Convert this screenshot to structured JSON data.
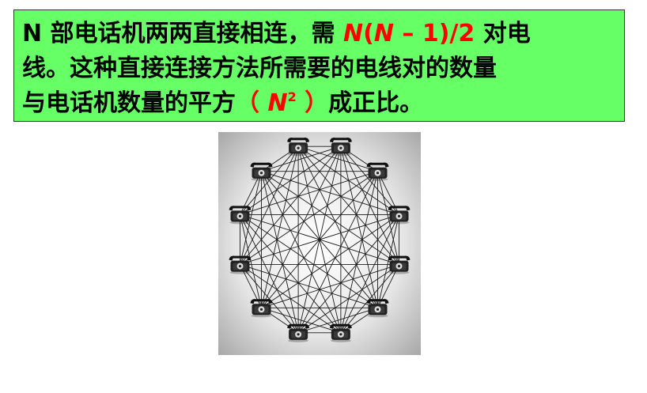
{
  "text_box": {
    "line1": {
      "prefix": "N 部电话机两两直接相连，需 ",
      "formula_n1": "N",
      "formula_open": "(",
      "formula_n2": "N",
      "formula_rest": " – 1)/2",
      "suffix": " 对电"
    },
    "line2": {
      "text": "线。这种直接连接方法所需要的电线对的数量"
    },
    "line3": {
      "prefix": "与电话机数量的平方",
      "paren_open": "（ ",
      "n": "N",
      "exp": "2",
      "paren_close": " ）",
      "suffix": "成正比。"
    },
    "highlight_color": "#ff0000",
    "background_color": "#66ff66"
  },
  "diagram": {
    "node_count": 12,
    "node_icon": "telephone-icon",
    "edge_color": "#1a1a1a"
  }
}
